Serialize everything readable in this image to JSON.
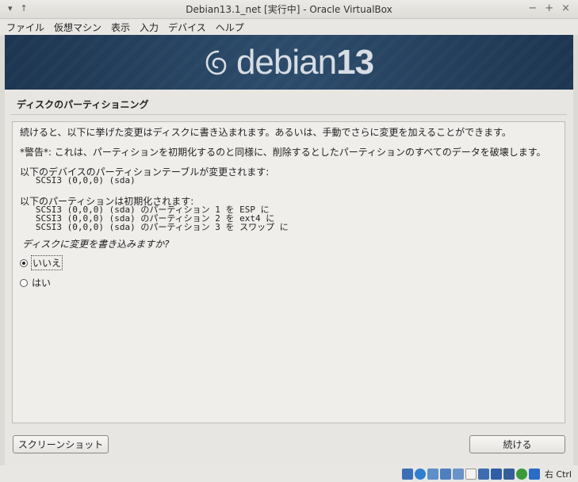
{
  "window": {
    "title": "Debian13.1_net [実行中] - Oracle VirtualBox",
    "left_controls": [
      "▾",
      "↑"
    ],
    "right_controls": [
      "−",
      "+",
      "×"
    ]
  },
  "menu": [
    "ファイル",
    "仮想マシン",
    "表示",
    "入力",
    "デバイス",
    "ヘルプ"
  ],
  "banner": {
    "logo_text": "debian",
    "logo_number": "13"
  },
  "installer": {
    "heading": "ディスクのパーティショニング",
    "intro": "続けると、以下に挙げた変更はディスクに書き込まれます。あるいは、手動でさらに変更を加えることができます。",
    "warning": "*警告*: これは、パーティションを初期化するのと同様に、削除するとしたパーティションのすべてのデータを破壊します。",
    "table_changes_label": "以下のデバイスのパーティションテーブルが変更されます:",
    "table_changes_device": "   SCSI3 (0,0,0) (sda)",
    "format_label": "以下のパーティションは初期化されます:",
    "format_items": [
      "   SCSI3 (0,0,0) (sda) のパーティション 1 を ESP に",
      "   SCSI3 (0,0,0) (sda) のパーティション 2 を ext4 に",
      "   SCSI3 (0,0,0) (sda) のパーティション 3 を スワップ に"
    ],
    "question": "ディスクに変更を書き込みますか?",
    "options": [
      {
        "label": "いいえ",
        "selected": true
      },
      {
        "label": "はい",
        "selected": false
      }
    ],
    "screenshot_button": "スクリーンショット",
    "continue_button": "続ける"
  },
  "statusbar": {
    "icons": [
      "hdd-icon",
      "optical-icon",
      "audio-icon",
      "network-icon",
      "usb-icon",
      "shared-folder-icon",
      "display-icon",
      "recording-icon",
      "cpu-icon",
      "mouse-integration-icon",
      "download-icon"
    ],
    "host_key": "右 Ctrl"
  }
}
